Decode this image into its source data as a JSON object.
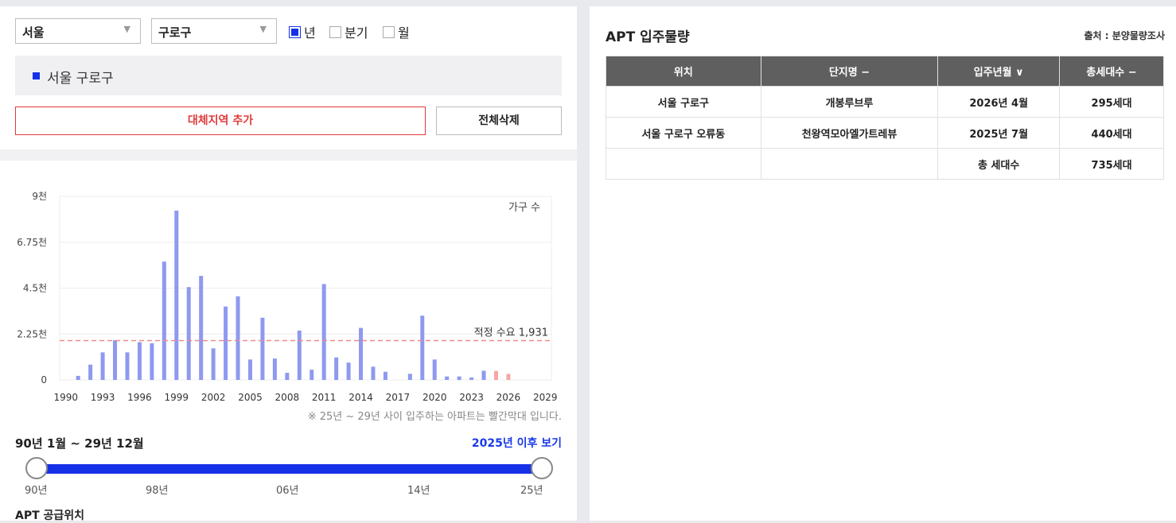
{
  "filters": {
    "region": "서울",
    "district": "구로구",
    "period_options": [
      {
        "label": "년",
        "checked": true
      },
      {
        "label": "분기",
        "checked": false
      },
      {
        "label": "월",
        "checked": false
      }
    ]
  },
  "legend": {
    "label": "서울 구로구",
    "color": "#1531e8"
  },
  "buttons": {
    "add_alt": "대체지역 추가",
    "delete_all": "전체삭제"
  },
  "chart_data": {
    "type": "bar",
    "series_label": "가구 수",
    "y_ticks": [
      "0",
      "2.25천",
      "4.5천",
      "6.75천",
      "9천"
    ],
    "ylim": [
      0,
      9000
    ],
    "x_ticks": [
      "1990",
      "1993",
      "1996",
      "1999",
      "2002",
      "2005",
      "2008",
      "2011",
      "2014",
      "2017",
      "2020",
      "2023",
      "2026",
      "2029"
    ],
    "xlim": [
      1989.5,
      2029.5
    ],
    "series": [
      {
        "name": "서울 구로구",
        "color": "#8e99ef",
        "x": [
          1991,
          1992,
          1993,
          1994,
          1995,
          1996,
          1997,
          1998,
          1999,
          2000,
          2001,
          2002,
          2003,
          2004,
          2005,
          2006,
          2007,
          2008,
          2009,
          2010,
          2011,
          2012,
          2013,
          2014,
          2015,
          2016,
          2017,
          2018,
          2019,
          2020,
          2021,
          2022,
          2023,
          2024
        ],
        "values": [
          200,
          750,
          1350,
          1950,
          1350,
          1850,
          1800,
          5800,
          8300,
          4550,
          5100,
          1550,
          3600,
          4100,
          1000,
          3050,
          1050,
          350,
          2420,
          500,
          4700,
          1100,
          850,
          2550,
          650,
          400,
          0,
          300,
          3150,
          1000,
          170,
          170,
          120,
          450
        ]
      },
      {
        "name": "25년 ~ 29년",
        "color": "#f6a7a4",
        "x": [
          2025,
          2026
        ],
        "values": [
          440,
          295
        ]
      }
    ],
    "reference_line": {
      "label": "적정 수요 1,931",
      "value": 1931,
      "color": "#f08a8a"
    }
  },
  "note": "※ 25년 ~ 29년 사이 입주하는 아파트는 빨간막대 입니다.",
  "range": {
    "label": "90년 1월 ~ 29년 12월",
    "link": "2025년 이후 보기",
    "ticks": [
      "90년",
      "98년",
      "06년",
      "14년",
      "25년"
    ]
  },
  "supply_title": "APT 공급위치",
  "right": {
    "title": "APT 입주물량",
    "source": "출처 : 분양물량조사",
    "headers": [
      "위치",
      "단지명 −",
      "입주년월 ∨",
      "총세대수 −"
    ],
    "rows": [
      [
        "서울 구로구",
        "개봉루브루",
        "2026년 4월",
        "295세대"
      ],
      [
        "서울 구로구 오류동",
        "천왕역모아엘가트레뷰",
        "2025년 7월",
        "440세대"
      ],
      [
        "",
        "",
        "총 세대수",
        "735세대"
      ]
    ]
  }
}
